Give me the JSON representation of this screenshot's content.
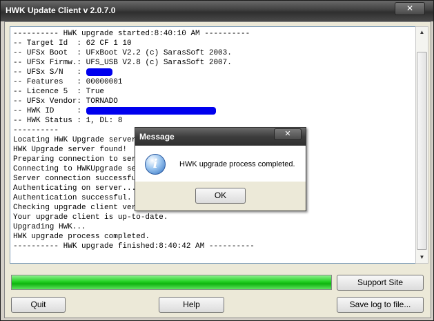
{
  "window": {
    "title": "HWK Update Client  v 2.0.7.0",
    "close_glyph": "✕"
  },
  "log_lines": [
    "---------- HWK upgrade started:8:40:10 AM ----------",
    "-- Target Id  : 62 CF 1 10",
    "-- UFSx Boot  : UFxBoot V2.2 (c) SarasSoft 2003.",
    "-- UFSx Firmw.: UFS_USB V2.8 (c) SarasSoft 2007.",
    "-- UFSx S/N   : ",
    "-- Features   : 00000001",
    "-- Licence 5  : True",
    "-- UFSx Vendor: TORNADO",
    "-- HWK ID     : ",
    "-- HWK Status : 1, DL: 8",
    "----------",
    "Locating HWK Upgrade server...",
    "HWK Upgrade server found!",
    "Preparing connection to server...",
    "Connecting to HWKUpgrade server...",
    "Server connection successful.",
    "Authenticating on server...",
    "Authentication successful.",
    "Checking upgrade client version...",
    "Your upgrade client is up-to-date.",
    "Upgrading HWK...",
    "HWK upgrade process completed.",
    "---------- HWK upgrade finished:8:40:42 AM ----------"
  ],
  "progress": {
    "value": 1.0,
    "color": "#22d022"
  },
  "buttons": {
    "support": "Support Site",
    "quit": "Quit",
    "help": "Help",
    "save_log": "Save log to file..."
  },
  "dialog": {
    "title": "Message",
    "message": "HWK upgrade process completed.",
    "ok": "OK",
    "icon": "info-icon",
    "close_glyph": "✕"
  },
  "colors": {
    "redaction": "#0000ee"
  }
}
